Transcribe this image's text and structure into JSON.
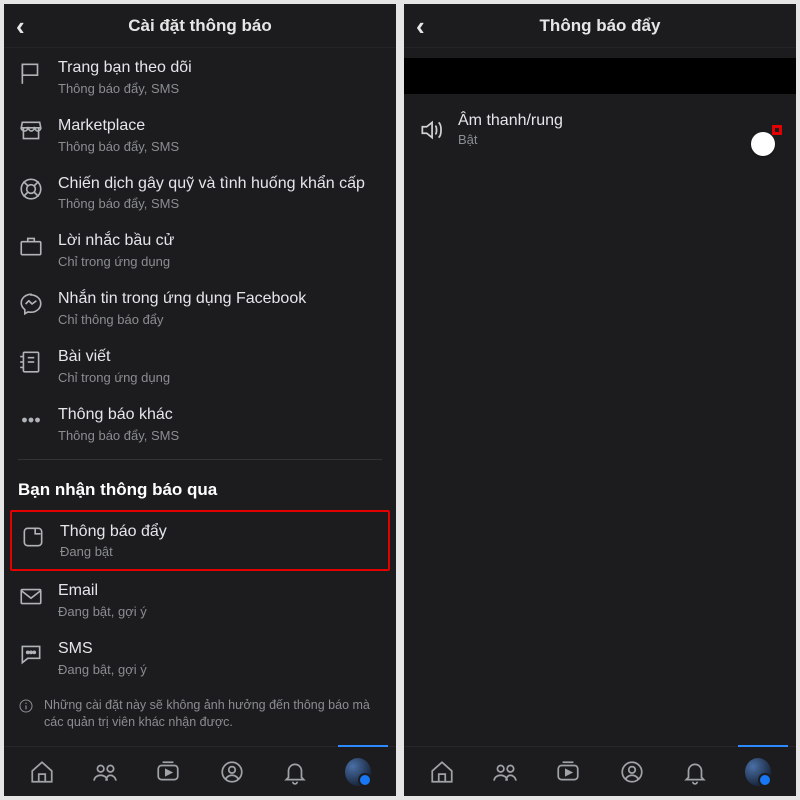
{
  "left": {
    "header": {
      "title": "Cài đặt thông báo"
    },
    "rows": [
      {
        "icon": "flag",
        "primary": "Trang bạn theo dõi",
        "secondary": "Thông báo đẩy, SMS"
      },
      {
        "icon": "store",
        "primary": "Marketplace",
        "secondary": "Thông báo đẩy, SMS"
      },
      {
        "icon": "lifebuoy",
        "primary": "Chiến dịch gây quỹ và tình huống khẩn cấp",
        "secondary": "Thông báo đẩy, SMS"
      },
      {
        "icon": "briefcase",
        "primary": "Lời nhắc bầu cử",
        "secondary": "Chỉ trong ứng dụng"
      },
      {
        "icon": "messenger",
        "primary": "Nhắn tin trong ứng dụng Facebook",
        "secondary": "Chỉ thông báo đẩy"
      },
      {
        "icon": "journal",
        "primary": "Bài viết",
        "secondary": "Chỉ trong ứng dụng"
      },
      {
        "icon": "dots",
        "primary": "Thông báo khác",
        "secondary": "Thông báo đẩy, SMS"
      }
    ],
    "sectionTitle": "Bạn nhận thông báo qua",
    "channels": [
      {
        "icon": "push",
        "primary": "Thông báo đẩy",
        "secondary": "Đang bật",
        "highlight": true
      },
      {
        "icon": "mail",
        "primary": "Email",
        "secondary": "Đang bật, gợi ý",
        "highlight": false
      },
      {
        "icon": "sms",
        "primary": "SMS",
        "secondary": "Đang bật, gợi ý",
        "highlight": false
      }
    ],
    "infoText": "Những cài đặt này sẽ không ảnh hưởng đến thông báo mà các quản trị viên khác nhận được."
  },
  "right": {
    "header": {
      "title": "Thông báo đẩy"
    },
    "toggle": {
      "primary": "Âm thanh/rung",
      "secondary": "Bật",
      "on": true
    }
  }
}
